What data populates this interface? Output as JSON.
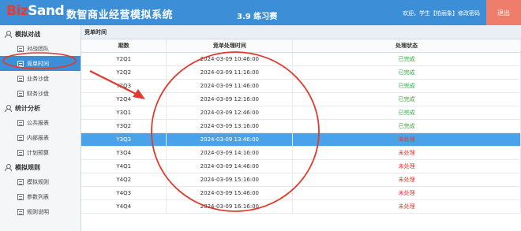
{
  "header": {
    "logo_biz": "Biz",
    "logo_sand": "Sand",
    "app_title": "数智商业经营模拟系统",
    "round_title": "3.9 练习赛",
    "welcome": "欢迎，学生【柏丽象】修改密码",
    "logout_label": "退出"
  },
  "sidebar": {
    "groups": [
      {
        "label": "模拟对战",
        "items": [
          "对战团队",
          "竞单时间",
          "业务沙盘",
          "财务沙盘"
        ]
      },
      {
        "label": "统计分析",
        "items": [
          "公共报表",
          "内部报表",
          "计划预算"
        ]
      },
      {
        "label": "模拟规则",
        "items": [
          "模拟规则",
          "参数列表",
          "规则说明"
        ]
      }
    ],
    "active_item": "竞单时间"
  },
  "main": {
    "panel_title": "竞单时间",
    "columns": [
      "期数",
      "竞单处理时间",
      "处理状态"
    ],
    "rows": [
      {
        "period": "Y2Q1",
        "time": "2024-03-09 10:46:00",
        "status": "已完成"
      },
      {
        "period": "Y2Q2",
        "time": "2024-03-09 11:16:00",
        "status": "已完成"
      },
      {
        "period": "Y2Q3",
        "time": "2024-03-09 11:46:00",
        "status": "已完成"
      },
      {
        "period": "Y2Q4",
        "time": "2024-03-09 12:16:00",
        "status": "已完成"
      },
      {
        "period": "Y3Q1",
        "time": "2024-03-09 12:46:00",
        "status": "已完成"
      },
      {
        "period": "Y3Q2",
        "time": "2024-03-09 13:16:00",
        "status": "已完成"
      },
      {
        "period": "Y3Q3",
        "time": "2024-03-09 13:46:00",
        "status": "未处理"
      },
      {
        "period": "Y3Q4",
        "time": "2024-03-09 14:16:00",
        "status": "未处理"
      },
      {
        "period": "Y4Q1",
        "time": "2024-03-09 14:46:00",
        "status": "未处理"
      },
      {
        "period": "Y4Q2",
        "time": "2024-03-09 15:16:00",
        "status": "未处理"
      },
      {
        "period": "Y4Q3",
        "time": "2024-03-09 15:46:00",
        "status": "未处理"
      },
      {
        "period": "Y4Q4",
        "time": "2024-03-09 16:16:00",
        "status": "未处理"
      }
    ],
    "selected_period": "Y3Q3"
  },
  "colors": {
    "header_blue": "#3c8fd6",
    "logout_bg": "#ef7d6b",
    "done_green": "#2fa83a",
    "pending_red": "#e03a2e",
    "selected_row": "#4aa3e8",
    "annotation_red": "#e03a2e"
  },
  "icons": {
    "group": "user-icon",
    "item": "document-icon"
  }
}
